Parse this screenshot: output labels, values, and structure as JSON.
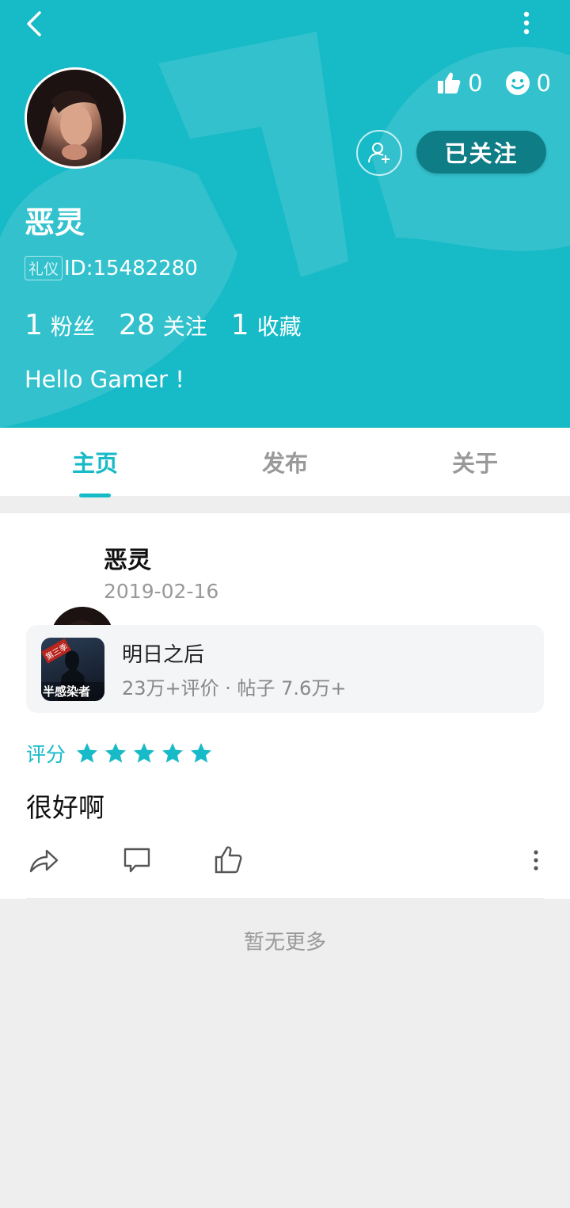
{
  "header": {
    "bg_color": "#17bac7",
    "likes_count": "0",
    "emoji_count": "0",
    "follow_button_label": "已关注",
    "username": "恶灵",
    "id_tag": "礼仪",
    "id_text": "ID:15482280",
    "stats": [
      {
        "num": "1",
        "label": "粉丝"
      },
      {
        "num": "28",
        "label": "关注"
      },
      {
        "num": "1",
        "label": "收藏"
      }
    ],
    "bio": "Hello Gamer !"
  },
  "tabs": [
    {
      "label": "主页",
      "active": true
    },
    {
      "label": "发布",
      "active": false
    },
    {
      "label": "关于",
      "active": false
    }
  ],
  "post": {
    "author": "恶灵",
    "date": "2019-02-16",
    "game": {
      "title": "明日之后",
      "meta": "23万+评价 · 帖子 7.6万+",
      "icon_text": "半感染者",
      "icon_badge": "第三季"
    },
    "rating_label": "评分",
    "rating_stars": 5,
    "comment": "很好啊"
  },
  "footer": {
    "no_more": "暂无更多"
  }
}
